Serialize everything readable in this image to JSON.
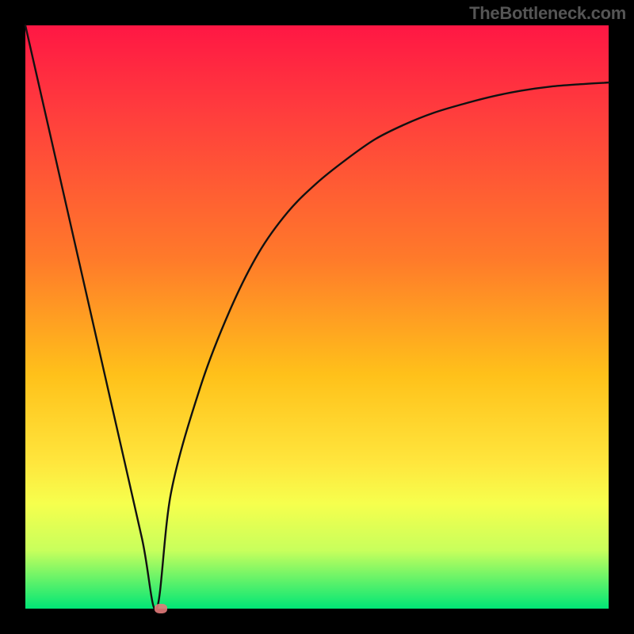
{
  "watermark": "TheBottleneck.com",
  "chart_data": {
    "type": "line",
    "title": "",
    "xlabel": "",
    "ylabel": "",
    "xlim": [
      0,
      100
    ],
    "ylim": [
      0,
      100
    ],
    "series": [
      {
        "name": "curve",
        "x": [
          0,
          5,
          10,
          15,
          20,
          22.5,
          25,
          30,
          35,
          40,
          45,
          50,
          55,
          60,
          65,
          70,
          75,
          80,
          85,
          90,
          95,
          100
        ],
        "values": [
          100,
          78,
          56,
          34,
          12,
          0,
          20,
          38,
          51,
          61,
          68,
          73,
          77,
          80.5,
          83,
          85,
          86.5,
          87.8,
          88.8,
          89.5,
          89.9,
          90.2
        ]
      }
    ],
    "marker": {
      "x": 23.2,
      "y": 0
    }
  },
  "colors": {
    "curve": "#111111",
    "marker": "#e27a7a",
    "gradient_top": "#ff1744",
    "gradient_bottom": "#00e676",
    "frame": "#000000"
  }
}
